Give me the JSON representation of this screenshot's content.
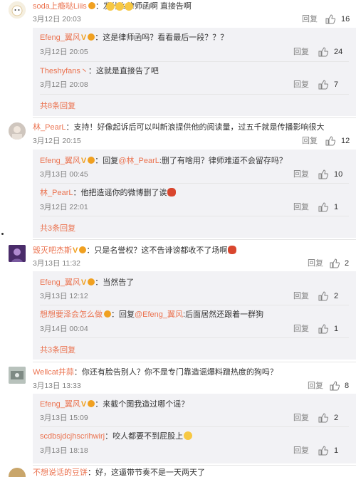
{
  "comments": [
    {
      "user": "soda上瘾哒Liiis",
      "text": "：发什么律师函啊 直接告啊",
      "time": "3月12日 20:03",
      "reply_label": "回复",
      "likes": "16",
      "replies": [
        {
          "user": "Efeng_翼风",
          "text": "：这是律师函吗？看看最后一段？？？",
          "time": "3月12日 20:05",
          "likes": "24"
        },
        {
          "user": "Theshyfans丶",
          "text": "：这就是直接告了吧",
          "time": "3月12日 20:08",
          "likes": "7"
        }
      ],
      "more": "共8条回复"
    },
    {
      "user": "林_PearL",
      "text": "：支持！好像起诉后可以叫新浪提供他的阅读量，过五千就是传播影响很大",
      "time": "3月12日 20:15",
      "reply_label": "回复",
      "likes": "12",
      "replies": [
        {
          "user": "Efeng_翼风",
          "text": "：回复",
          "mention": "@林_PearL",
          "text2": ":删了有啥用？律师难道不会留存吗？",
          "time": "3月13日 00:45",
          "likes": "10"
        },
        {
          "user": "林_PearL",
          "text": "：他把造谣你的微博删了诶",
          "time": "3月12日 22:01",
          "likes": "1"
        }
      ],
      "more": "共3条回复"
    },
    {
      "user": "毁灭吧杰斯",
      "text": "：只是名誉权？这不告诽谤都收不了场啊",
      "time": "3月13日 11:32",
      "reply_label": "回复",
      "likes": "2",
      "replies": [
        {
          "user": "Efeng_翼风",
          "text": "：当然告了",
          "time": "3月13日 12:12",
          "likes": "2"
        },
        {
          "user": "想想要泽会怎么做",
          "text": "：回复",
          "mention": "@Efeng_翼风",
          "text2": ":后面居然还跟着一群狗",
          "time": "3月14日 00:04",
          "likes": "1"
        }
      ],
      "more": "共3条回复"
    },
    {
      "user": "Wellcat井蒜",
      "text": "：你还有脸告别人？你不是专门靠造谣爆料蹭热度的狗吗？",
      "time": "3月13日 13:33",
      "reply_label": "回复",
      "likes": "8",
      "replies": [
        {
          "user": "Efeng_翼风",
          "text": "：来截个图我造过哪个谣？",
          "time": "3月13日 15:09",
          "likes": "2"
        },
        {
          "user": "scdbsjdcjhscrihwirj",
          "text": "：咬人都要不到屁股上",
          "time": "3月13日 18:18",
          "likes": "1"
        }
      ]
    },
    {
      "user": "不想说话的豆饼",
      "text": "：好，这逼带节奏不是一天两天了"
    }
  ],
  "reply_label": "回复",
  "colors": {
    "name": "#eb7350",
    "text": "#333333",
    "meta": "#808080",
    "reply_bg": "#f2f2f5"
  }
}
